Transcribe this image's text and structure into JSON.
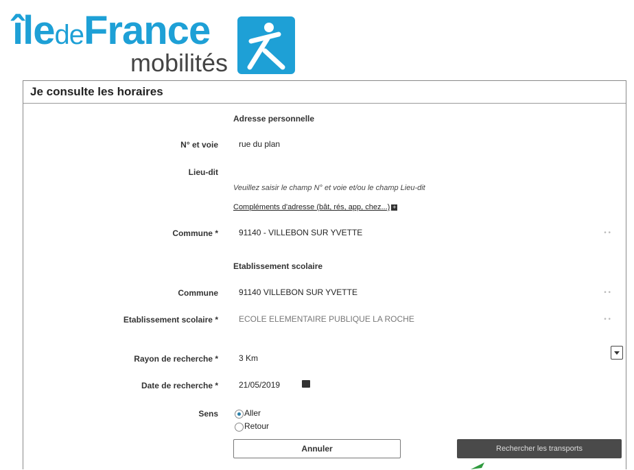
{
  "brand": {
    "ile": "île",
    "de": "de",
    "france": "France",
    "mobilites": "mobilités",
    "badge_color": "#1ea0d6"
  },
  "panel": {
    "title": "Je consulte les horaires"
  },
  "personal_address": {
    "section_title": "Adresse personnelle",
    "street_label": "N° et voie",
    "street_value": "rue du plan",
    "lieu_dit_label": "Lieu-dit",
    "lieu_dit_value": "",
    "hint": "Veuillez saisir le champ N° et voie et/ou le champ Lieu-dit",
    "complement_link": "Compléments d'adresse (bât, rés, app, chez...)",
    "commune_label": "Commune *",
    "commune_value": "91140 - VILLEBON SUR YVETTE"
  },
  "school": {
    "section_title": "Etablissement scolaire",
    "commune_label": "Commune",
    "commune_value": "91140 VILLEBON SUR YVETTE",
    "etab_label": "Etablissement scolaire *",
    "etab_value": "ECOLE ELEMENTAIRE PUBLIQUE LA ROCHE"
  },
  "search": {
    "radius_label": "Rayon de recherche *",
    "radius_value": "3 Km",
    "date_label": "Date de recherche *",
    "date_value": "21/05/2019",
    "sens_label": "Sens",
    "aller_label": "Aller",
    "retour_label": "Retour",
    "selected_direction": "Aller"
  },
  "buttons": {
    "cancel": "Annuler",
    "search": "Rechercher les transports"
  },
  "colors": {
    "accent_arrow": "#2e9a3e",
    "search_button": "#4a4a4a"
  }
}
